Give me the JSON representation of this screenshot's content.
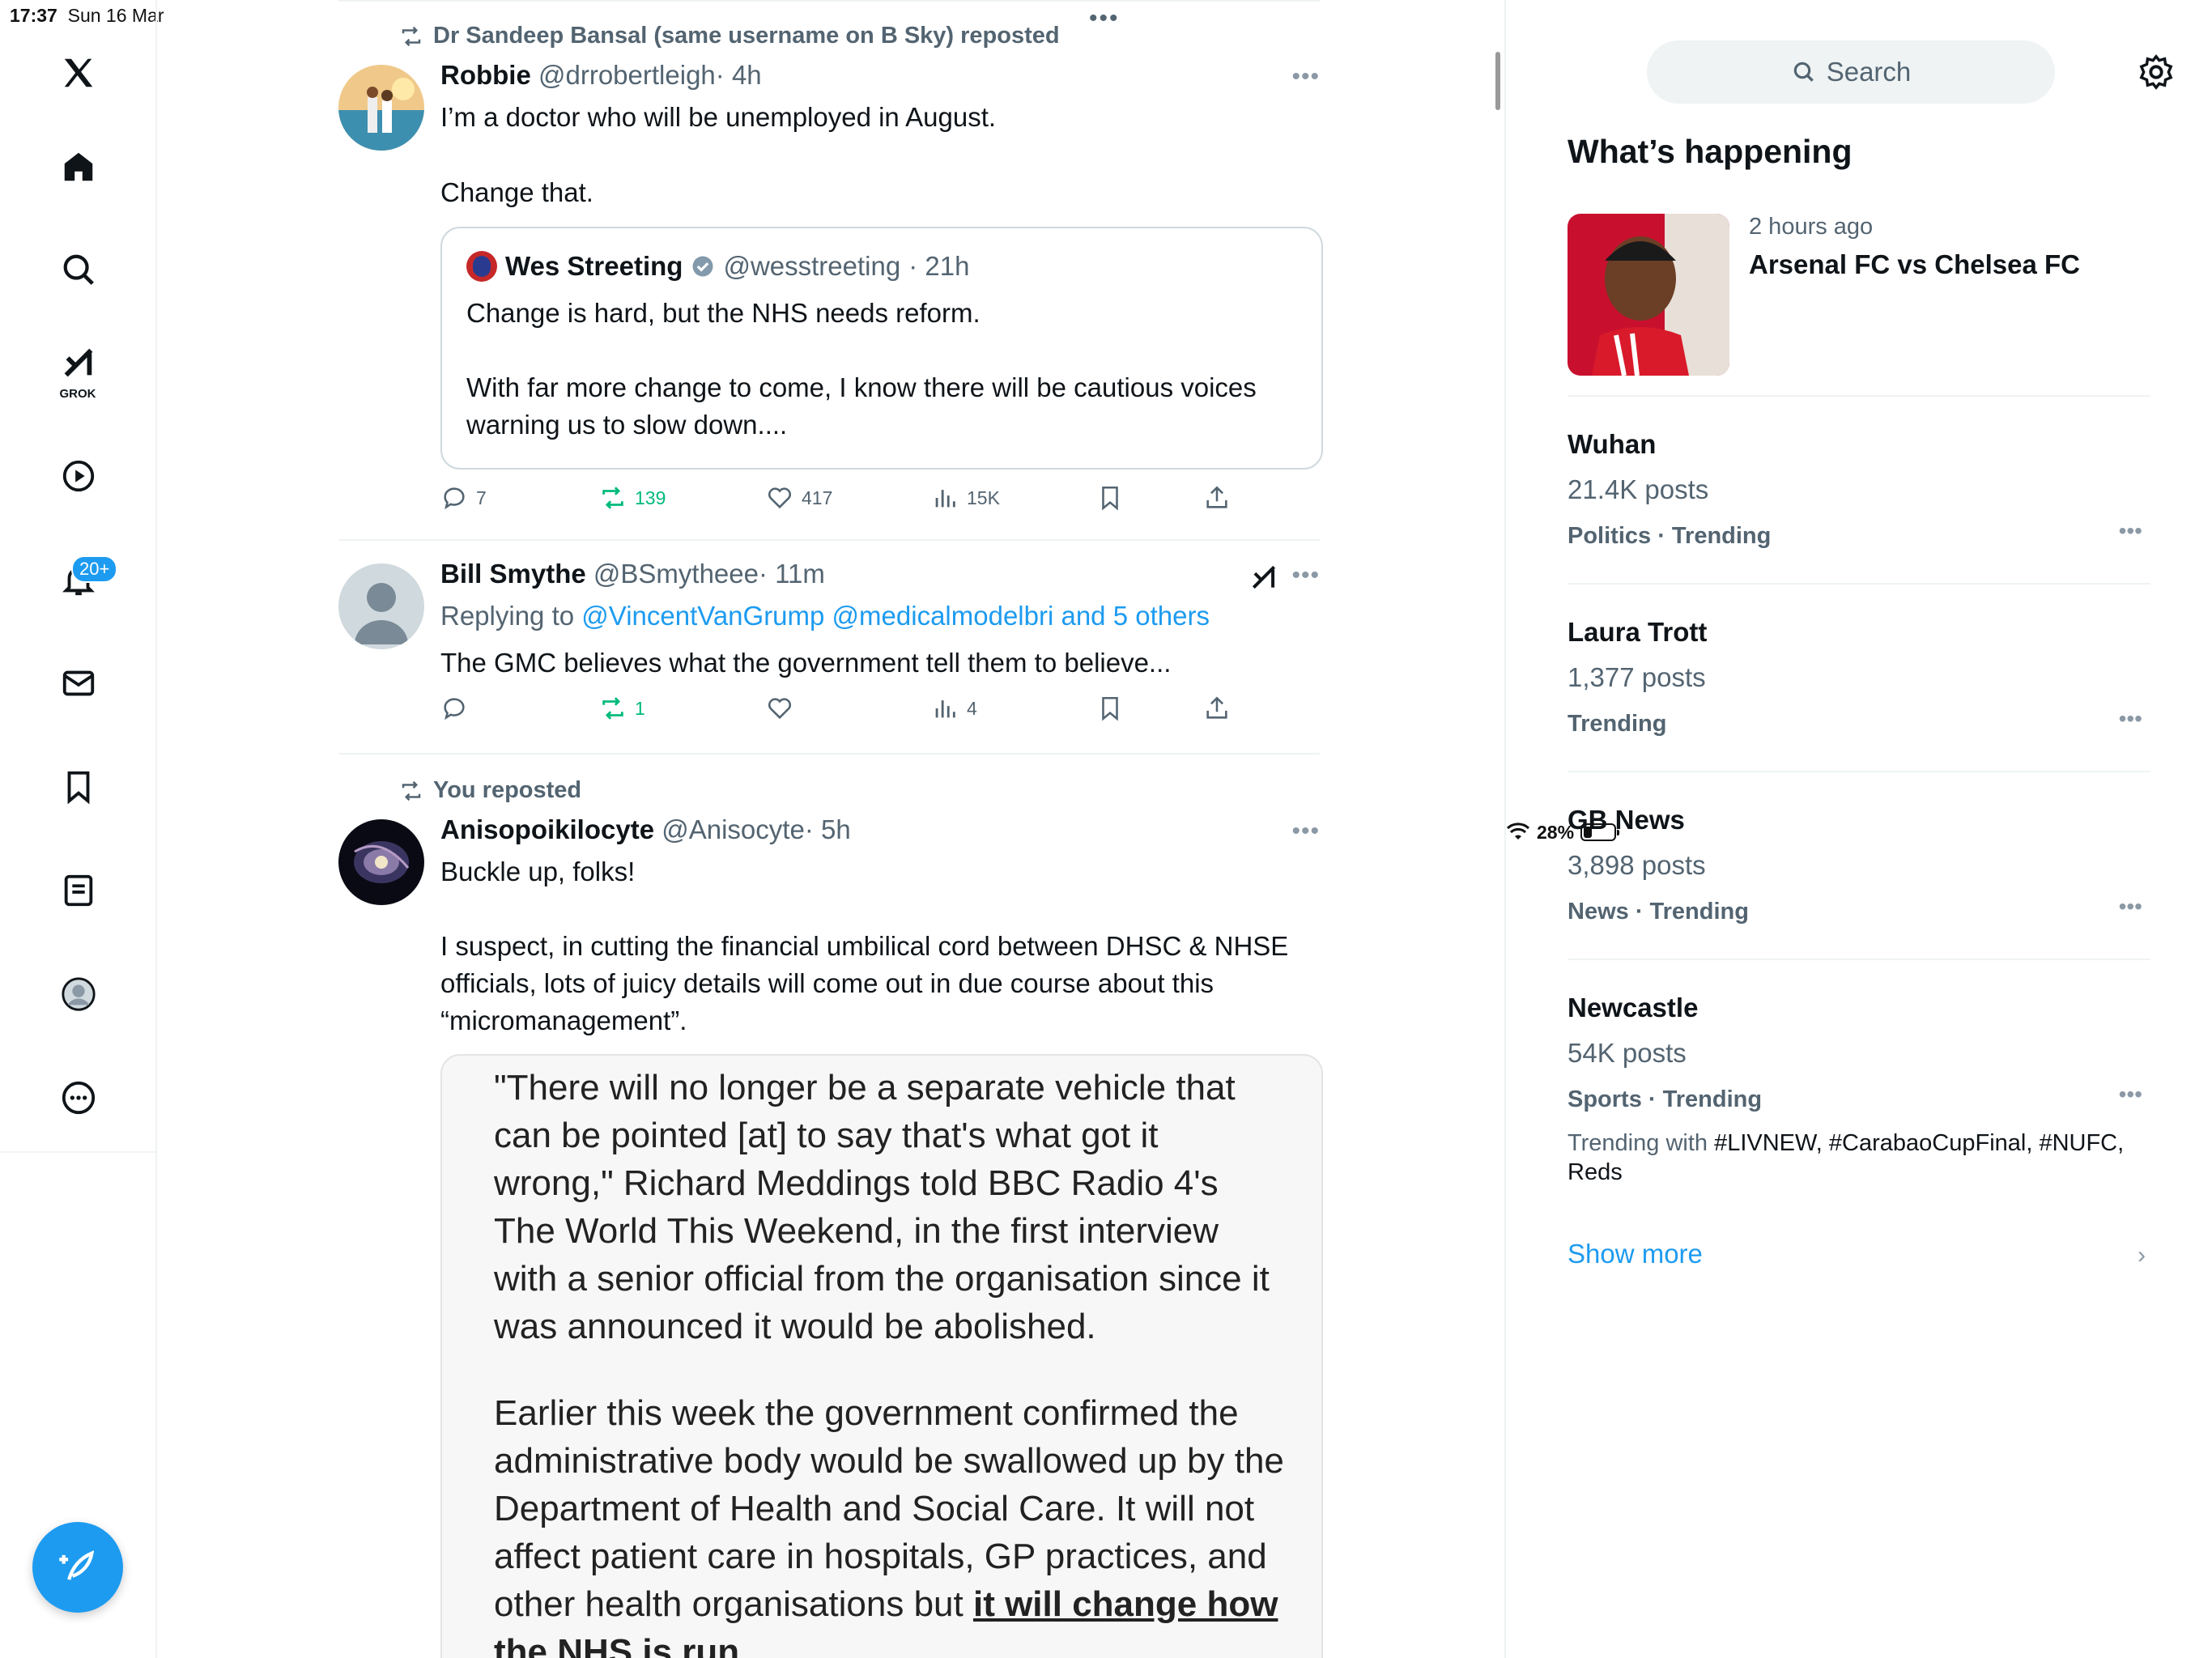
{
  "status": {
    "time": "17:37",
    "date": "Sun 16 Mar",
    "battery": "28%",
    "battery_level": 0.28
  },
  "nav": {
    "items": [
      "home-icon",
      "search-icon",
      "grok-icon",
      "video-icon",
      "notifications-icon",
      "messages-icon",
      "bookmarks-icon",
      "lists-icon",
      "profile-icon",
      "more-icon"
    ],
    "grok_label": "GROK",
    "notif_badge": "20+"
  },
  "feed": {
    "post1": {
      "social": "Dr Sandeep Bansal (same username on B Sky) reposted",
      "name": "Robbie",
      "handle": "@drrobertleigh",
      "time": "· 4h",
      "text1": "I’m a doctor who will be unemployed in August.",
      "text2": "Change that.",
      "quote": {
        "name": "Wes Streeting",
        "handle": "@wesstreeting",
        "time": "· 21h",
        "text1": "Change is hard, but the NHS needs reform.",
        "text2": "With far more change to come, I know there will be cautious voices warning us to slow down...."
      },
      "replies": "7",
      "reposts": "139",
      "likes": "417",
      "views": "15K"
    },
    "post2": {
      "name": "Bill Smythe",
      "handle": "@BSmytheee",
      "time": "· 11m",
      "replying_prefix": "Replying to",
      "replying_links": "@VincentVanGrump @medicalmodelbri and 5 others",
      "text": "The GMC believes what the government tell them to believe...",
      "reposts": "1",
      "views": "4"
    },
    "post3": {
      "social": "You reposted",
      "name": "Anisopoikilocyte",
      "handle": "@Anisocyte",
      "time": "· 5h",
      "text1": "Buckle up, folks!",
      "text2": "I suspect, in cutting the financial umbilical cord between DHSC & NHSE officials, lots of juicy details will come out in due course about this “micromanagement”.",
      "article_p1": "\"There will no longer be a separate vehicle that can be pointed [at] to say that's what got it wrong,\" Richard Meddings told BBC Radio 4's The World This Weekend, in the first interview with a senior official from the organisation since it was announced it would be abolished.",
      "article_p2_start": "Earlier this week the government confirmed the administrative body would be swallowed up by the Department of Health and Social Care. It will not affect patient care in hospitals, GP practices, and other health organisations but ",
      "article_p2_underline": "it will change how the NHS is run."
    }
  },
  "sidebar": {
    "search_placeholder": "Search",
    "title": "What’s happening",
    "event": {
      "time": "2 hours ago",
      "title": "Arsenal FC vs Chelsea FC"
    },
    "trends": [
      {
        "name": "Wuhan",
        "posts": "21.4K posts",
        "category": "Politics · Trending"
      },
      {
        "name": "Laura Trott",
        "posts": "1,377 posts",
        "category": "Trending"
      },
      {
        "name": "GB News",
        "posts": "3,898 posts",
        "category": "News · Trending"
      },
      {
        "name": "Newcastle",
        "posts": "54K posts",
        "category": "Sports · Trending",
        "with_prefix": "Trending with",
        "with_tags": "#LIVNEW, #CarabaoCupFinal, #NUFC,",
        "with_rest": "Reds"
      }
    ],
    "show_more": "Show more"
  },
  "colors": {
    "accent": "#1d9bf0",
    "repost_green": "#00ba7c",
    "muted": "#536471"
  }
}
